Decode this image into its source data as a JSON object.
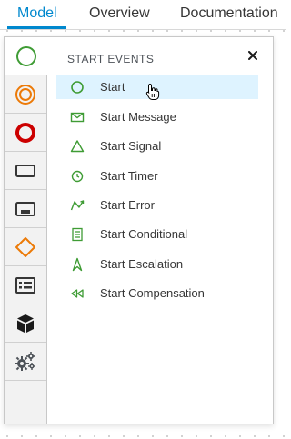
{
  "tabs": [
    {
      "label": "Model",
      "active": true
    },
    {
      "label": "Overview",
      "active": false
    },
    {
      "label": "Documentation",
      "active": false
    }
  ],
  "sidebar": {
    "items": [
      {
        "name": "start-events",
        "icon": "start-event-icon",
        "color": "#3f9c35",
        "active": true
      },
      {
        "name": "intermediate-events",
        "icon": "intermediate-event-icon",
        "color": "#ec7a08",
        "active": false
      },
      {
        "name": "end-events",
        "icon": "end-event-icon",
        "color": "#cc0000",
        "active": false
      },
      {
        "name": "tasks",
        "icon": "task-icon",
        "color": "#363636",
        "active": false
      },
      {
        "name": "subprocesses",
        "icon": "subprocess-icon",
        "color": "#363636",
        "active": false
      },
      {
        "name": "gateways",
        "icon": "gateway-icon",
        "color": "#ec7a08",
        "active": false
      },
      {
        "name": "containers",
        "icon": "container-icon",
        "color": "#363636",
        "active": false
      },
      {
        "name": "artifacts",
        "icon": "cube-icon",
        "color": "#1a1a1a",
        "active": false
      },
      {
        "name": "custom-tasks",
        "icon": "gears-icon",
        "color": "#4d5258",
        "active": false
      }
    ]
  },
  "panel": {
    "title": "START EVENTS",
    "close_icon": "close-icon",
    "items": [
      {
        "label": "Start",
        "icon": "start-none-icon",
        "hover": true
      },
      {
        "label": "Start Message",
        "icon": "start-message-icon",
        "hover": false
      },
      {
        "label": "Start Signal",
        "icon": "start-signal-icon",
        "hover": false
      },
      {
        "label": "Start Timer",
        "icon": "start-timer-icon",
        "hover": false
      },
      {
        "label": "Start Error",
        "icon": "start-error-icon",
        "hover": false
      },
      {
        "label": "Start Conditional",
        "icon": "start-conditional-icon",
        "hover": false
      },
      {
        "label": "Start Escalation",
        "icon": "start-escalation-icon",
        "hover": false
      },
      {
        "label": "Start Compensation",
        "icon": "start-compensation-icon",
        "hover": false
      }
    ]
  },
  "colors": {
    "accent": "#0088ce",
    "event_green": "#3f9c35",
    "hover_bg": "#def3ff"
  }
}
